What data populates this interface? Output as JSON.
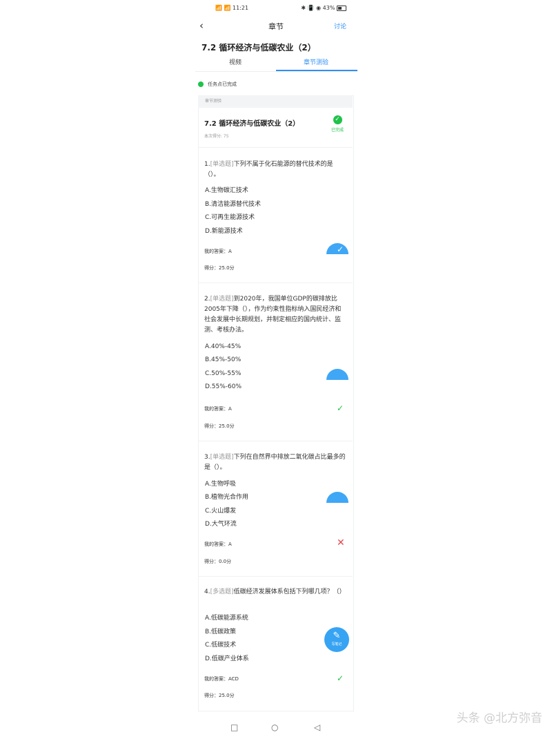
{
  "status_bar": {
    "left_text": "📶 📶 11:21",
    "right_text": "✱ 📳 ◉ 43%"
  },
  "header": {
    "back_icon": "chevron-left-icon",
    "title": "章节",
    "discuss": "讨论"
  },
  "chapter_title": "7.2 循环经济与低碳农业（2）",
  "tabs": [
    {
      "label": "视频"
    },
    {
      "label": "章节测验"
    }
  ],
  "task_status": "任务点已完成",
  "quiz": {
    "section_label": "章节测验",
    "title": "7.2 循环经济与低碳农业（2）",
    "score_text": "本次得分: 75",
    "badge_label": "已完成"
  },
  "questions": [
    {
      "num": "1.",
      "type": "[单选题]",
      "text": "下列不属于化石能源的替代技术的是（）。",
      "options": [
        "A.生物碳汇技术",
        "B.清洁能源替代技术",
        "C.可再生能源技术",
        "D.新能源技术"
      ],
      "my_answer": "我的答案：A",
      "score": "得分：25.0分",
      "result": "check"
    },
    {
      "num": "2.",
      "type": "[单选题]",
      "text": "到2020年，我国单位GDP的碳排放比2005年下降（），作为约束性指标纳入国民经济和社会发展中长期规划，并制定相应的国内统计、监测、考核办法。",
      "options": [
        "A.40%-45%",
        "B.45%-50%",
        "C.50%-55%",
        "D.55%-60%"
      ],
      "my_answer": "我的答案：A",
      "score": "得分：25.0分",
      "result": "check"
    },
    {
      "num": "3.",
      "type": "[单选题]",
      "text": "下列在自然界中排放二氧化碳占比最多的是（）。",
      "options": [
        "A.生物呼吸",
        "B.植物光合作用",
        "C.火山爆发",
        "D.大气环流"
      ],
      "my_answer": "我的答案：A",
      "score": "得分：0.0分",
      "result": "cross"
    },
    {
      "num": "4.",
      "type": "[多选题]",
      "text": "低碳经济发展体系包括下列哪几项？（）",
      "options": [
        "A.低碳能源系统",
        "B.低碳政策",
        "C.低碳技术",
        "D.低碳产业体系"
      ],
      "my_answer": "我的答案：ACD",
      "score": "得分：25.0分",
      "result": "check"
    }
  ],
  "fab": {
    "label": "写笔记",
    "icon": "edit-note-icon"
  },
  "watermark": "头条 @北方弥音",
  "nav": {
    "square": "□",
    "circle": "○",
    "back": "◁"
  }
}
